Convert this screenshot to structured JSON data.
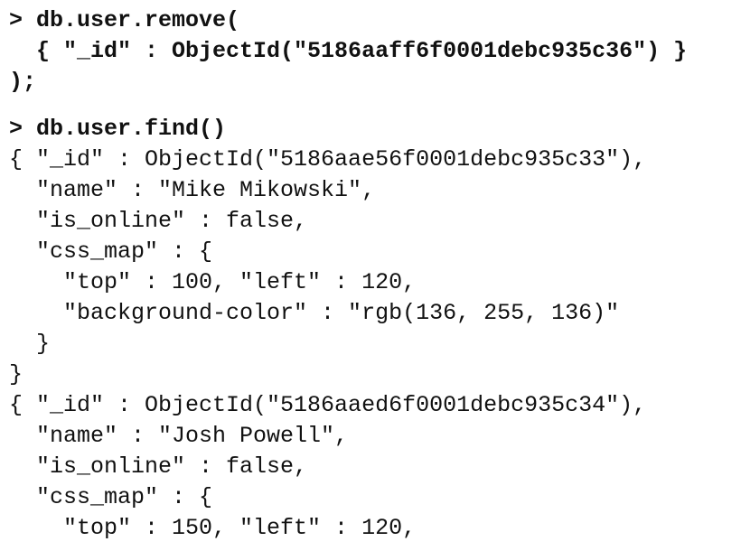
{
  "terminal": {
    "block1": {
      "line1": "> db.user.remove(",
      "line2": "  { \"_id\" : ObjectId(\"5186aaff6f0001debc935c36\") }",
      "line3": ");"
    },
    "block2": {
      "line1": "> db.user.find()",
      "line2": "{ \"_id\" : ObjectId(\"5186aae56f0001debc935c33\"),",
      "line3": "  \"name\" : \"Mike Mikowski\",",
      "line4": "  \"is_online\" : false,",
      "line5": "  \"css_map\" : {",
      "line6": "    \"top\" : 100, \"left\" : 120,",
      "line7": "    \"background-color\" : \"rgb(136, 255, 136)\"",
      "line8": "  }",
      "line9": "}",
      "line10": "{ \"_id\" : ObjectId(\"5186aaed6f0001debc935c34\"),",
      "line11": "  \"name\" : \"Josh Powell\",",
      "line12": "  \"is_online\" : false,",
      "line13": "  \"css_map\" : {",
      "line14": "    \"top\" : 150, \"left\" : 120,"
    }
  }
}
